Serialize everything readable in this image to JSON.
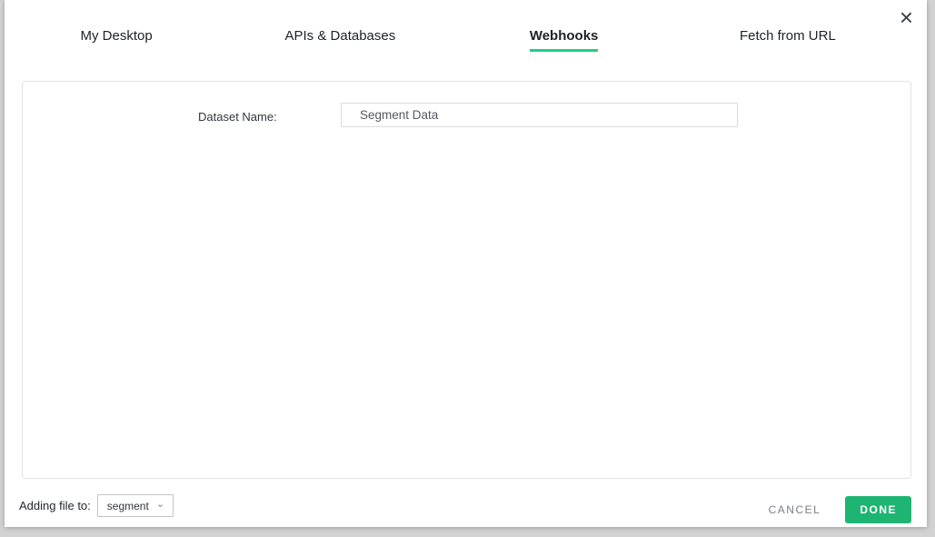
{
  "modal": {
    "tabs": [
      {
        "label": "My Desktop",
        "active": false
      },
      {
        "label": "APIs & Databases",
        "active": false
      },
      {
        "label": "Webhooks",
        "active": true
      },
      {
        "label": "Fetch from URL",
        "active": false
      }
    ],
    "form": {
      "dataset_name_label": "Dataset Name:",
      "dataset_name_value": "Segment Data"
    },
    "footer": {
      "adding_file_label": "Adding file to:",
      "folder_select_value": "segment",
      "cancel_label": "CANCEL",
      "done_label": "DONE"
    },
    "icons": {
      "close": "×",
      "chevron_down": "⌄"
    },
    "colors": {
      "accent_green_underline": "#1dd185",
      "button_green": "#1eb573",
      "panel_border": "#e2e2e6",
      "page_background": "#d2d2d2"
    }
  }
}
